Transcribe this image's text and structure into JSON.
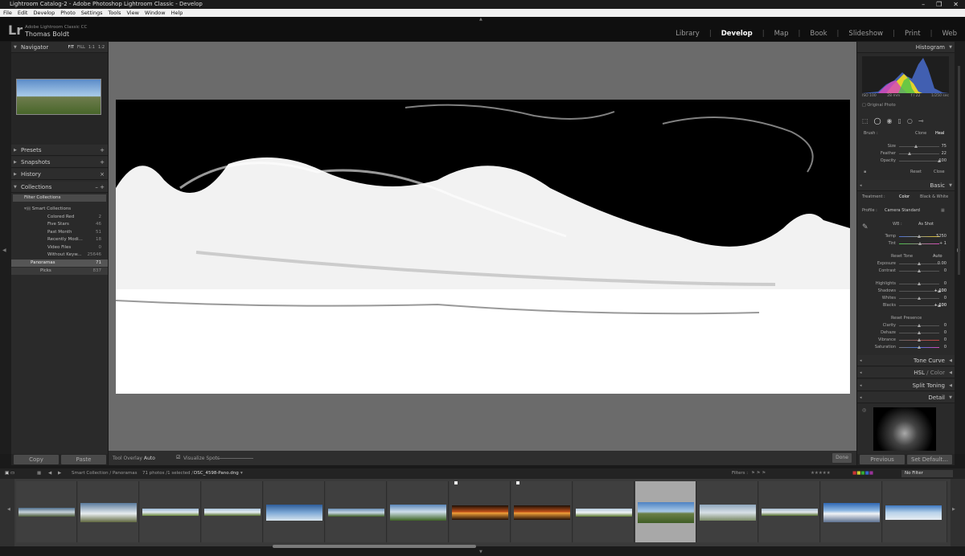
{
  "window": {
    "title": "Lightroom Catalog-2 - Adobe Photoshop Lightroom Classic - Develop",
    "controls": [
      "–",
      "❐",
      "✕"
    ]
  },
  "menu": [
    "File",
    "Edit",
    "Develop",
    "Photo",
    "Settings",
    "Tools",
    "View",
    "Window",
    "Help"
  ],
  "identity": {
    "logo": "Lr",
    "product": "Adobe Lightroom Classic CC",
    "user": "Thomas Boldt"
  },
  "modules": [
    {
      "label": "Library",
      "active": false
    },
    {
      "label": "Develop",
      "active": true
    },
    {
      "label": "Map",
      "active": false
    },
    {
      "label": "Book",
      "active": false
    },
    {
      "label": "Slideshow",
      "active": false
    },
    {
      "label": "Print",
      "active": false
    },
    {
      "label": "Web",
      "active": false
    }
  ],
  "navigator": {
    "title": "Navigator",
    "zoom_options": [
      "FIT",
      "FILL",
      "1:1",
      "1:2"
    ]
  },
  "left_sections": {
    "presets": "Presets",
    "snapshots": "Snapshots",
    "history": "History",
    "collections": "Collections"
  },
  "collections": {
    "filter": "Filter Collections",
    "smart_title": "Smart Collections",
    "items": [
      {
        "name": "Colored Red",
        "count": "2"
      },
      {
        "name": "Five Stars",
        "count": "46"
      },
      {
        "name": "Past Month",
        "count": "51"
      },
      {
        "name": "Recently Modi...",
        "count": "18"
      },
      {
        "name": "Video Files",
        "count": "0"
      },
      {
        "name": "Without Keyw...",
        "count": "25646"
      }
    ],
    "panoramas": {
      "name": "Panoramas",
      "count": "71"
    },
    "picks": {
      "name": "Picks",
      "count": "837"
    }
  },
  "left_buttons": {
    "copy": "Copy",
    "paste": "Paste"
  },
  "toolbar": {
    "tool_overlay_label": "Tool Overlay :",
    "tool_overlay_value": "Auto",
    "visualize": "Visualize Spots",
    "done": "Done"
  },
  "histogram": {
    "title": "Histogram",
    "iso": "ISO 100",
    "focal": "28 mm",
    "aperture": "f / 22",
    "shutter": "1/250 sec",
    "original": "Original Photo"
  },
  "spot": {
    "brush_label": "Brush :",
    "clone": "Clone",
    "heal": "Heal",
    "size_label": "Size",
    "size": "75",
    "feather_label": "Feather",
    "feather": "22",
    "opacity_label": "Opacity",
    "opacity": "100",
    "reset": "Reset",
    "close": "Close"
  },
  "basic": {
    "title": "Basic",
    "treatment_label": "Treatment :",
    "color": "Color",
    "bw": "Black & White",
    "profile_label": "Profile :",
    "profile": "Camera Standard",
    "wb_label": "WB :",
    "wb": "As Shot",
    "temp_label": "Temp",
    "temp": "5250",
    "tint_label": "Tint",
    "tint": "+ 1",
    "reset_tone": "Reset Tone",
    "auto": "Auto",
    "exposure_label": "Exposure",
    "exposure": "0.00",
    "contrast_label": "Contrast",
    "contrast": "0",
    "highlights_label": "Highlights",
    "highlights": "0",
    "shadows_label": "Shadows",
    "shadows": "+ 100",
    "whites_label": "Whites",
    "whites": "0",
    "blacks_label": "Blacks",
    "blacks": "+ 100",
    "reset_presence": "Reset Presence",
    "clarity_label": "Clarity",
    "clarity": "0",
    "dehaze_label": "Dehaze",
    "dehaze": "0",
    "vibrance_label": "Vibrance",
    "vibrance": "0",
    "saturation_label": "Saturation",
    "saturation": "0"
  },
  "right_sections": {
    "tone_curve": "Tone Curve",
    "hsl": "HSL",
    "hsl_sep": " / ",
    "color": "Color",
    "split": "Split Toning",
    "detail": "Detail"
  },
  "right_buttons": {
    "previous": "Previous",
    "set_default": "Set Default..."
  },
  "filmstrip": {
    "breadcrumb": "Smart Collection / Panoramas",
    "count": "71 photos /1 selected /",
    "file": "DSC_4598-Pano.dng",
    "filter_label": "Filters :",
    "filter_value": "No Filter"
  }
}
